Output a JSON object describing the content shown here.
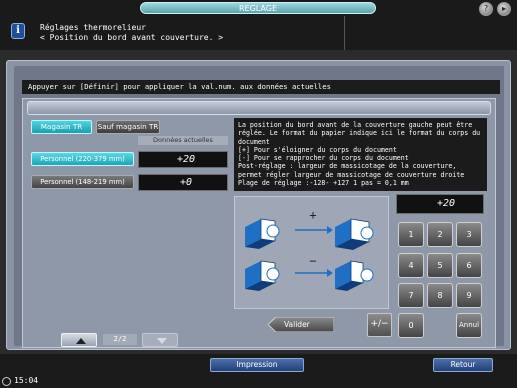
{
  "header": {
    "title": "REGLAGE",
    "message_line1": "Réglages thermorelieur",
    "message_line2": "< Position du bord avant couverture. >",
    "help_icon": "question-icon",
    "menu_icon": "arrow-icon"
  },
  "instruction": "Appuyer sur [Définir] pour appliquer la val.num. aux données actuelles",
  "tabs": [
    {
      "label": "Magasin TR",
      "active": true
    },
    {
      "label": "Sauf magasin TR",
      "active": false
    }
  ],
  "current_data_label": "Données actuelles",
  "rows": [
    {
      "label": "Personnel (220-379 mm)",
      "value": "+20",
      "active": true
    },
    {
      "label": "Personnel (148-219 mm)",
      "value": "+0",
      "active": false
    }
  ],
  "pager": {
    "indicator": "2/2"
  },
  "description": "La position du bord avant de la couverture gauche peut être réglée. Le format du papier indique ici le format du corps du document\n[+] Pour s'éloigner du corps du document\n[-] Pour se rapprocher du corps du document\nPost-réglage : largeur de massicotage de la couverture, permet régler largeur de massicotage de couverture droite\nPlage de réglage :-128- +127 1 pas = 0,1 mm",
  "diagram": {
    "plus": "+",
    "minus": "−"
  },
  "valider_label": "Valider",
  "plusminus_label": "+/−",
  "keypad": {
    "display": "+20",
    "keys": [
      "1",
      "2",
      "3",
      "4",
      "5",
      "6",
      "7",
      "8",
      "9",
      "0"
    ],
    "cancel": "Annul"
  },
  "footer": {
    "impression": "Impression",
    "retour": "Retour",
    "clock": "15:04"
  },
  "colors": {
    "accent": "#1ca6b8",
    "footer_button": "#22417b"
  }
}
